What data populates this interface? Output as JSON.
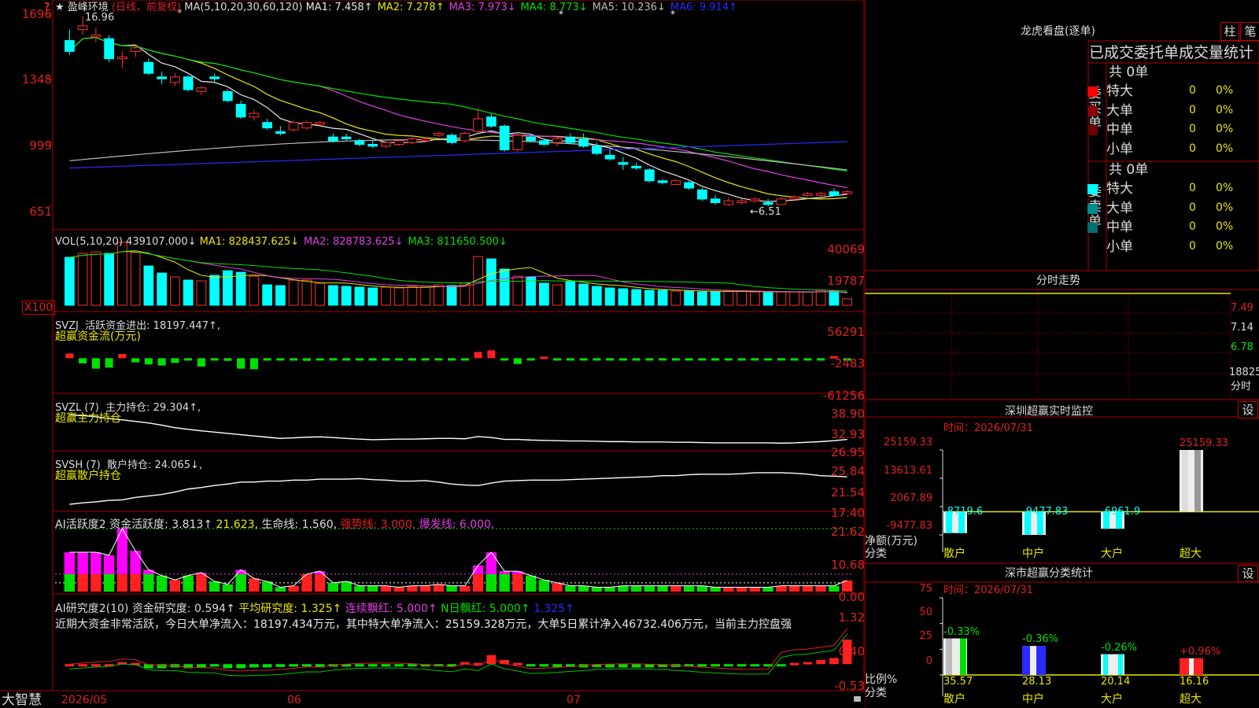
{
  "stock": {
    "name": "盈峰环境",
    "period": "(日线，前复权)",
    "star": "★"
  },
  "question_mark": "?",
  "main_ind": {
    "ma_param": "MA(5,10,20,30,60,120)",
    "items": [
      {
        "label": "MA1:",
        "value": "7.458↑",
        "color": "#e8e8e8"
      },
      {
        "label": "MA2:",
        "value": "7.278↑",
        "color": "#e8e800"
      },
      {
        "label": "MA3:",
        "value": "7.973↓",
        "color": "#e040e0"
      },
      {
        "label": "MA4:",
        "value": "8.773↓",
        "color": "#00e000"
      },
      {
        "label": "MA5:",
        "value": "10.236↓",
        "color": "#bbbbbb"
      },
      {
        "label": "MA6:",
        "value": "9.914↑",
        "color": "#2a2aff"
      }
    ],
    "high_label": "16.96",
    "low_label": "←6.51",
    "y_labels": [
      "1696",
      "1348",
      "999",
      "651"
    ]
  },
  "vol": {
    "title": "VOL(5,10,20)",
    "value": "439107.000↓",
    "items": [
      {
        "label": "MA1:",
        "value": "828437.625↓",
        "color": "#e8e800"
      },
      {
        "label": "MA2:",
        "value": "828783.625↓",
        "color": "#e040e0"
      },
      {
        "label": "MA3:",
        "value": "811650.500↓",
        "color": "#00e000"
      }
    ],
    "y_labels": [
      "40069",
      "19787"
    ],
    "unit": "X100"
  },
  "svzj": {
    "title": "SVZJ",
    "line1": "活跃资金进出: 18197.447↑,",
    "line2": "超赢资金流(万元)",
    "y_labels": [
      "56291",
      "-2483",
      "-61256"
    ]
  },
  "svzl": {
    "title": "SVZL (7)",
    "line1": "主力持仓: 29.304↑,",
    "line2": "超赢主力持仓",
    "y_labels": [
      "38.90",
      "32.93",
      "26.95"
    ]
  },
  "svsh": {
    "title": "SVSH (7)",
    "line1": "散户持仓: 24.065↓,",
    "line2": "超赢散户持仓",
    "y_labels": [
      "25.84",
      "21.54",
      "17.40"
    ]
  },
  "ai_act": {
    "title": "AI活跃度2",
    "label": "资金活跃度:",
    "value": "3.813↑",
    "v2": "21.623,",
    "life_label": "生命线:",
    "life_value": "1.560,",
    "strong": "强势线: 3.000,",
    "burst": "爆发线: 6.000,",
    "y_labels": [
      "21.62",
      "10.68",
      "0.00"
    ]
  },
  "ai_res": {
    "title": "AI研究度2(10)",
    "label": "资金研究度:",
    "value": "0.594↑",
    "avg": "平均研究度: 1.325↑",
    "cont": "连续飘红: 5.000↑",
    "nday": "N日飘红: 5.000↑",
    "last": "1.325↑",
    "desc": "近期大资金非常活跃，今日大单净流入：18197.434万元，其中特大单净流入：25159.328万元，大单5日累计净入46732.406万元，当前主力控盘强",
    "y_labels": [
      "1.32",
      "0.40",
      "-0.53"
    ]
  },
  "x_axis": {
    "labels": [
      "2026/05",
      "06",
      "07"
    ]
  },
  "brand": "大智慧",
  "lhb": {
    "title": "龙虎看盘(逐单)",
    "btn_zhu": "柱",
    "btn_bi": "笔",
    "header": "已成交委托单成交量统计",
    "buy": {
      "side": "委买单",
      "total": "共 0单",
      "rows": [
        {
          "name": "特大",
          "count": "0",
          "pct": "0%",
          "color": "#ff0000"
        },
        {
          "name": "大单",
          "count": "0",
          "pct": "0%",
          "color": "#8b0000"
        },
        {
          "name": "中单",
          "count": "0",
          "pct": "0%",
          "color": "#6b0000"
        },
        {
          "name": "小单",
          "count": "0",
          "pct": "0%",
          "color": "#000000"
        }
      ]
    },
    "sell": {
      "side": "委卖单",
      "total": "共 0单",
      "rows": [
        {
          "name": "特大",
          "count": "0",
          "pct": "0%",
          "color": "#00ffff"
        },
        {
          "name": "大单",
          "count": "0",
          "pct": "0%",
          "color": "#008b8b"
        },
        {
          "name": "中单",
          "count": "0",
          "pct": "0%",
          "color": "#007070"
        },
        {
          "name": "小单",
          "count": "0",
          "pct": "0%",
          "color": "#000000"
        }
      ]
    }
  },
  "fenshi": {
    "title": "分时走势",
    "y_labels": [
      "7.49",
      "7.14",
      "6.78"
    ],
    "vol": "18825",
    "vol_unit": "分时"
  },
  "monitor": {
    "title": "深圳超赢实时监控",
    "btn": "设",
    "time": "时间：2026/07/31",
    "y_labels": [
      "25159.33",
      "13613.61",
      "2067.89",
      "-9477.83"
    ],
    "ylabel1": "净额(万元)",
    "ylabel2": "分类",
    "bars": [
      {
        "cat": "散户",
        "value": -8719.6,
        "label": "-8719.6"
      },
      {
        "cat": "中户",
        "value": -9477.83,
        "label": "-9477.83"
      },
      {
        "cat": "大户",
        "value": -6961.9,
        "label": "-6961.9"
      },
      {
        "cat": "超大",
        "value": 25159.33,
        "label": "25159.33"
      }
    ]
  },
  "classify": {
    "title": "深市超赢分类统计",
    "btn": "设",
    "time": "时间：2026/07/31",
    "y_labels": [
      "75",
      "50",
      "25",
      "0"
    ],
    "ylabel1": "比例%",
    "ylabel2": "分类",
    "bars": [
      {
        "cat": "散户",
        "value": 35.57,
        "label": "35.57",
        "chg": "-0.33%",
        "color": "#00e000"
      },
      {
        "cat": "中户",
        "value": 28.13,
        "label": "28.13",
        "chg": "-0.36%",
        "color": "#2a2aff"
      },
      {
        "cat": "大户",
        "value": 20.14,
        "label": "20.14",
        "chg": "-0.26%",
        "color": "#00ffff"
      },
      {
        "cat": "超大",
        "value": 16.16,
        "label": "16.16",
        "chg": "+0.96%",
        "color": "#ff2020"
      }
    ]
  },
  "chart_data": {
    "type": "candlestick",
    "title": "盈峰环境 日线",
    "ohlc": [
      [
        15.6,
        16.2,
        14.8,
        15.0
      ],
      [
        16.2,
        16.96,
        15.9,
        16.4
      ],
      [
        15.8,
        16.3,
        15.5,
        15.9
      ],
      [
        15.7,
        15.9,
        14.4,
        14.6
      ],
      [
        14.6,
        15.0,
        14.1,
        14.7
      ],
      [
        15.0,
        15.4,
        14.7,
        15.2
      ],
      [
        14.4,
        14.6,
        13.7,
        13.8
      ],
      [
        13.6,
        13.9,
        13.2,
        13.5
      ],
      [
        13.3,
        13.8,
        13.1,
        13.6
      ],
      [
        13.6,
        13.7,
        12.8,
        12.9
      ],
      [
        12.8,
        13.1,
        12.6,
        13.0
      ],
      [
        13.6,
        13.8,
        13.3,
        13.5
      ],
      [
        12.8,
        12.9,
        12.2,
        12.3
      ],
      [
        12.1,
        12.3,
        11.3,
        11.4
      ],
      [
        11.4,
        11.8,
        11.2,
        11.6
      ],
      [
        11.1,
        11.3,
        10.7,
        10.8
      ],
      [
        10.6,
        10.9,
        10.4,
        10.5
      ],
      [
        10.7,
        11.2,
        10.6,
        11.1
      ],
      [
        10.8,
        11.2,
        10.7,
        11.1
      ],
      [
        11.0,
        11.2,
        10.9,
        11.1
      ],
      [
        10.3,
        10.5,
        10.0,
        10.1
      ],
      [
        10.3,
        10.5,
        10.1,
        10.2
      ],
      [
        10.1,
        10.2,
        9.8,
        9.9
      ],
      [
        9.9,
        10.1,
        9.7,
        9.8
      ],
      [
        9.8,
        10.1,
        9.7,
        10.0
      ],
      [
        9.9,
        10.2,
        9.8,
        10.1
      ],
      [
        10.0,
        10.3,
        9.9,
        10.2
      ],
      [
        10.1,
        10.3,
        10.0,
        10.2
      ],
      [
        10.4,
        10.6,
        10.3,
        10.5
      ],
      [
        10.4,
        10.5,
        9.9,
        10.0
      ],
      [
        10.1,
        10.6,
        10.0,
        10.5
      ],
      [
        10.6,
        11.9,
        10.5,
        11.3
      ],
      [
        11.4,
        11.6,
        10.8,
        10.9
      ],
      [
        10.9,
        11.0,
        9.5,
        9.6
      ],
      [
        9.6,
        10.5,
        9.5,
        10.4
      ],
      [
        10.3,
        10.5,
        10.0,
        10.1
      ],
      [
        10.1,
        10.2,
        9.8,
        9.9
      ],
      [
        10.0,
        10.3,
        9.8,
        10.2
      ],
      [
        10.3,
        10.5,
        9.9,
        10.0
      ],
      [
        10.2,
        10.5,
        9.7,
        9.8
      ],
      [
        9.8,
        10.0,
        9.3,
        9.4
      ],
      [
        9.3,
        9.6,
        9.0,
        9.1
      ],
      [
        8.9,
        9.2,
        8.5,
        8.8
      ],
      [
        8.7,
        8.9,
        8.5,
        8.6
      ],
      [
        8.5,
        8.6,
        7.8,
        7.9
      ],
      [
        7.9,
        8.0,
        7.7,
        7.8
      ],
      [
        7.7,
        8.0,
        7.7,
        7.9
      ],
      [
        7.8,
        7.9,
        7.4,
        7.5
      ],
      [
        7.4,
        7.5,
        6.8,
        6.9
      ],
      [
        6.9,
        7.1,
        6.6,
        6.7
      ],
      [
        6.6,
        7.0,
        6.51,
        6.8
      ],
      [
        6.7,
        6.9,
        6.6,
        6.8
      ],
      [
        6.8,
        7.0,
        6.7,
        6.9
      ],
      [
        6.7,
        6.9,
        6.5,
        6.6
      ],
      [
        6.6,
        7.0,
        6.6,
        6.9
      ],
      [
        6.9,
        7.1,
        6.8,
        7.0
      ],
      [
        7.1,
        7.3,
        7.0,
        7.2
      ],
      [
        7.1,
        7.3,
        7.0,
        7.2
      ],
      [
        7.3,
        7.5,
        7.1,
        7.1
      ],
      [
        7.2,
        7.4,
        7.1,
        7.3
      ]
    ],
    "volume_x100": [
      30500,
      33000,
      34000,
      33000,
      40069,
      33500,
      25000,
      20500,
      18000,
      16000,
      15500,
      19000,
      22000,
      21000,
      18500,
      13000,
      12500,
      16000,
      16000,
      14000,
      12500,
      12000,
      11500,
      11000,
      11500,
      11000,
      12000,
      11500,
      13000,
      12500,
      14000,
      31000,
      29500,
      23000,
      18500,
      18000,
      14000,
      13000,
      15000,
      13500,
      12000,
      11000,
      10500,
      10000,
      9500,
      9500,
      9000,
      9000,
      8500,
      8500,
      9000,
      9000,
      8500,
      8000,
      8500,
      8500,
      8500,
      9500,
      9000,
      4069
    ],
    "svzj": [
      9000,
      -10000,
      -20000,
      -18000,
      8000,
      -8000,
      -12000,
      -14000,
      -9000,
      -4000,
      -16000,
      -3000,
      -5000,
      -20000,
      -21000,
      -4000,
      -4000,
      -2000,
      -5000,
      -3000,
      -2000,
      -4000,
      -3000,
      -3000,
      -2000,
      -2000,
      -3000,
      -2000,
      -2000,
      -2000,
      -4000,
      12000,
      15000,
      -1000,
      -11000,
      -1000,
      3000,
      -3000,
      -2000,
      -4000,
      -2000,
      -3000,
      -2000,
      -4000,
      -3000,
      -2000,
      -3000,
      -2000,
      -3000,
      -2000,
      -3000,
      -3000,
      -2000,
      -2000,
      -4000,
      -2000,
      -2000,
      -2000,
      4000,
      -2000
    ],
    "svzl": [
      37.0,
      36.8,
      36.5,
      35.9,
      35.5,
      35.0,
      34.5,
      33.8,
      33.0,
      32.5,
      32.0,
      31.6,
      31.2,
      30.8,
      30.4,
      30.0,
      29.6,
      29.8,
      30.0,
      30.1,
      29.9,
      29.6,
      29.4,
      29.2,
      29.3,
      29.4,
      29.4,
      29.5,
      29.6,
      29.6,
      29.5,
      30.2,
      29.9,
      29.3,
      29.3,
      29.1,
      29.0,
      28.9,
      28.8,
      28.8,
      28.7,
      28.6,
      28.6,
      28.5,
      28.5,
      28.5,
      28.4,
      28.4,
      28.3,
      28.2,
      28.2,
      28.2,
      28.2,
      28.2,
      28.1,
      28.2,
      28.4,
      28.6,
      28.9,
      29.304
    ],
    "svsh": [
      18.5,
      18.8,
      19.0,
      19.3,
      19.4,
      19.9,
      20.2,
      20.5,
      21.0,
      21.6,
      21.9,
      22.3,
      22.6,
      23.0,
      23.0,
      23.2,
      23.2,
      23.4,
      23.4,
      23.6,
      23.6,
      23.6,
      23.7,
      23.5,
      23.4,
      23.2,
      23.2,
      23.3,
      23.0,
      22.6,
      22.4,
      22.3,
      22.8,
      23.2,
      23.3,
      23.4,
      23.4,
      23.4,
      23.5,
      23.6,
      23.7,
      23.8,
      23.9,
      24.0,
      24.1,
      24.3,
      24.3,
      24.5,
      24.6,
      24.6,
      24.6,
      24.7,
      24.9,
      24.9,
      24.9,
      24.8,
      24.6,
      24.3,
      24.2,
      24.065
    ],
    "ai_act": [
      13.5,
      13.5,
      13.5,
      12.5,
      21.62,
      14.0,
      7.5,
      5.5,
      4.0,
      5.5,
      6.5,
      3.5,
      2.5,
      7.5,
      4.5,
      3.5,
      1.5,
      2.0,
      6.0,
      7.0,
      3.0,
      3.5,
      2.0,
      2.0,
      2.0,
      1.5,
      2.0,
      2.0,
      2.5,
      2.0,
      2.0,
      9.0,
      13.5,
      7.0,
      7.0,
      5.5,
      4.0,
      3.0,
      2.0,
      2.0,
      1.5,
      1.5,
      2.0,
      2.0,
      2.0,
      2.0,
      2.0,
      2.0,
      2.0,
      1.5,
      1.5,
      1.5,
      1.5,
      1.5,
      2.0,
      2.0,
      2.0,
      2.0,
      2.0,
      3.813
    ],
    "ai_res": [
      0.0,
      0.0,
      0.0,
      0.0,
      0.05,
      0.03,
      -0.1,
      -0.1,
      -0.08,
      -0.1,
      -0.08,
      -0.06,
      -0.1,
      -0.1,
      -0.08,
      -0.08,
      -0.07,
      -0.06,
      -0.05,
      -0.08,
      -0.06,
      -0.06,
      -0.06,
      -0.06,
      -0.06,
      -0.05,
      -0.05,
      -0.05,
      -0.05,
      -0.05,
      0.05,
      0.03,
      0.22,
      0.1,
      0.03,
      -0.05,
      -0.06,
      -0.07,
      -0.07,
      -0.08,
      -0.07,
      -0.08,
      -0.08,
      -0.08,
      -0.08,
      -0.07,
      -0.07,
      -0.06,
      -0.06,
      -0.05,
      -0.05,
      -0.05,
      -0.05,
      -0.05,
      -0.04,
      0.03,
      0.05,
      0.1,
      0.15,
      0.594
    ],
    "ranges": {
      "price": [
        6.2,
        17.0
      ],
      "volume": [
        0,
        40069
      ],
      "svzj": [
        -61256,
        56291
      ],
      "svzl": [
        26.95,
        38.9
      ],
      "svsh": [
        17.4,
        25.84
      ],
      "ai_act": [
        0,
        21.62
      ],
      "ai_res": [
        -0.53,
        1.32
      ]
    }
  }
}
